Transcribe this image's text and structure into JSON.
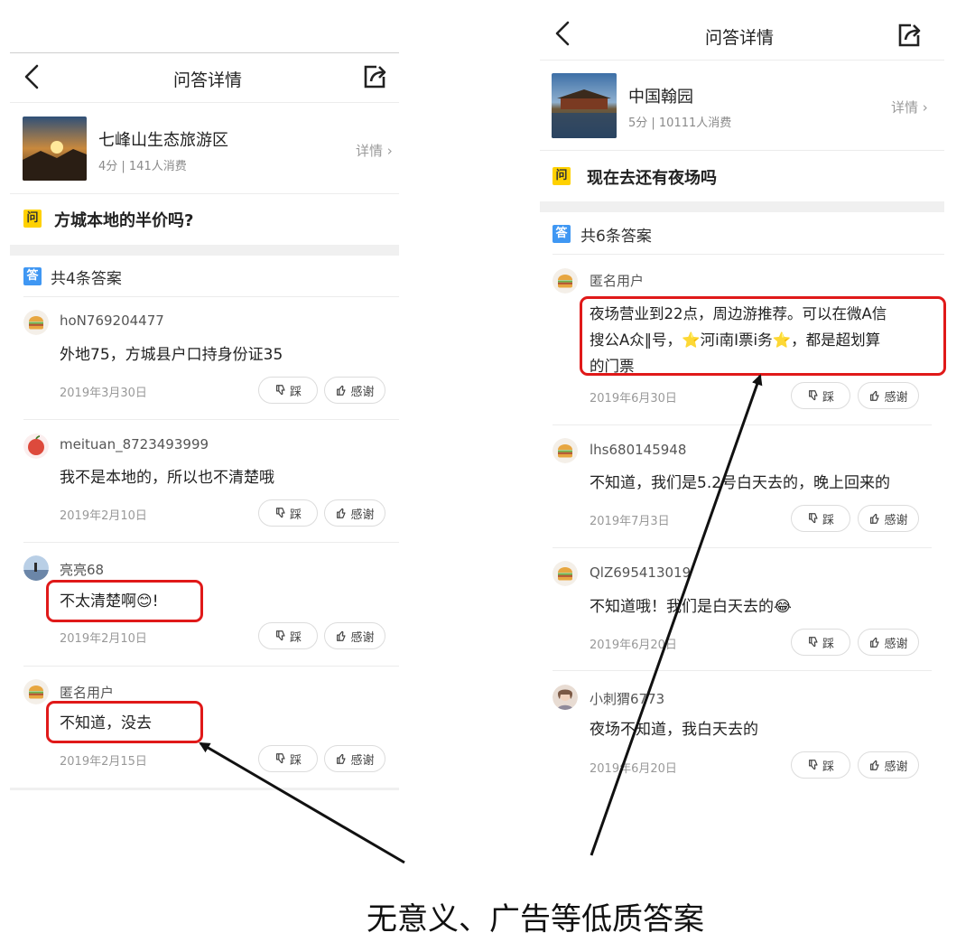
{
  "left": {
    "header": {
      "title": "问答详情"
    },
    "poi": {
      "name": "七峰山生态旅游区",
      "meta": "4分 | 141人消费",
      "detail": "详情 ›"
    },
    "question": {
      "badge": "问",
      "text": "方城本地的半价吗?"
    },
    "answers_header": {
      "badge": "答",
      "count": "共4条答案"
    },
    "answers": [
      {
        "user": "hoN769204477",
        "text": "外地75，方城县户口持身份证35",
        "date": "2019年3月30日",
        "dislike": "踩",
        "thanks": "感谢"
      },
      {
        "user": "meituan_8723493999",
        "text": "我不是本地的，所以也不清楚哦",
        "date": "2019年2月10日",
        "dislike": "踩",
        "thanks": "感谢"
      },
      {
        "user": "亮亮68",
        "text": "不太清楚啊😊!",
        "date": "2019年2月10日",
        "dislike": "踩",
        "thanks": "感谢"
      },
      {
        "user": "匿名用户",
        "text": "不知道，没去",
        "date": "2019年2月15日",
        "dislike": "踩",
        "thanks": "感谢"
      }
    ]
  },
  "right": {
    "header": {
      "title": "问答详情"
    },
    "poi": {
      "name": "中国翰园",
      "meta": "5分 | 10111人消费",
      "detail": "详情 ›"
    },
    "question": {
      "badge": "问",
      "text": "现在去还有夜场吗"
    },
    "answers_header": {
      "badge": "答",
      "count": "共6条答案"
    },
    "answers": [
      {
        "user": "匿名用户",
        "line1": "夜场营业到22点，周边游推荐。可以在微A信",
        "line2": "搜公A众‖号，⭐河i南I票i务⭐，都是超划算",
        "line3": "的门票",
        "date": "2019年6月30日",
        "dislike": "踩",
        "thanks": "感谢"
      },
      {
        "user": "lhs680145948",
        "text": "不知道，我们是5.2号白天去的，晚上回来的",
        "date": "2019年7月3日",
        "dislike": "踩",
        "thanks": "感谢"
      },
      {
        "user": "QlZ695413019",
        "text": "不知道哦！我们是白天去的😂",
        "date": "2019年6月20日",
        "dislike": "踩",
        "thanks": "感谢"
      },
      {
        "user": "小刺猬6773",
        "text": "夜场不知道，我白天去的",
        "date": "2019年6月20日",
        "dislike": "踩",
        "thanks": "感谢"
      }
    ]
  },
  "caption": "无意义、广告等低质答案",
  "colors": {
    "highlight": "#e01919",
    "question_badge": "#ffd100",
    "answer_badge": "#3f97f3"
  },
  "icons": [
    "back-arrow-icon",
    "share-icon",
    "thumbs-down-icon",
    "thumbs-up-icon",
    "burger-avatar-icon",
    "apple-avatar-icon"
  ]
}
